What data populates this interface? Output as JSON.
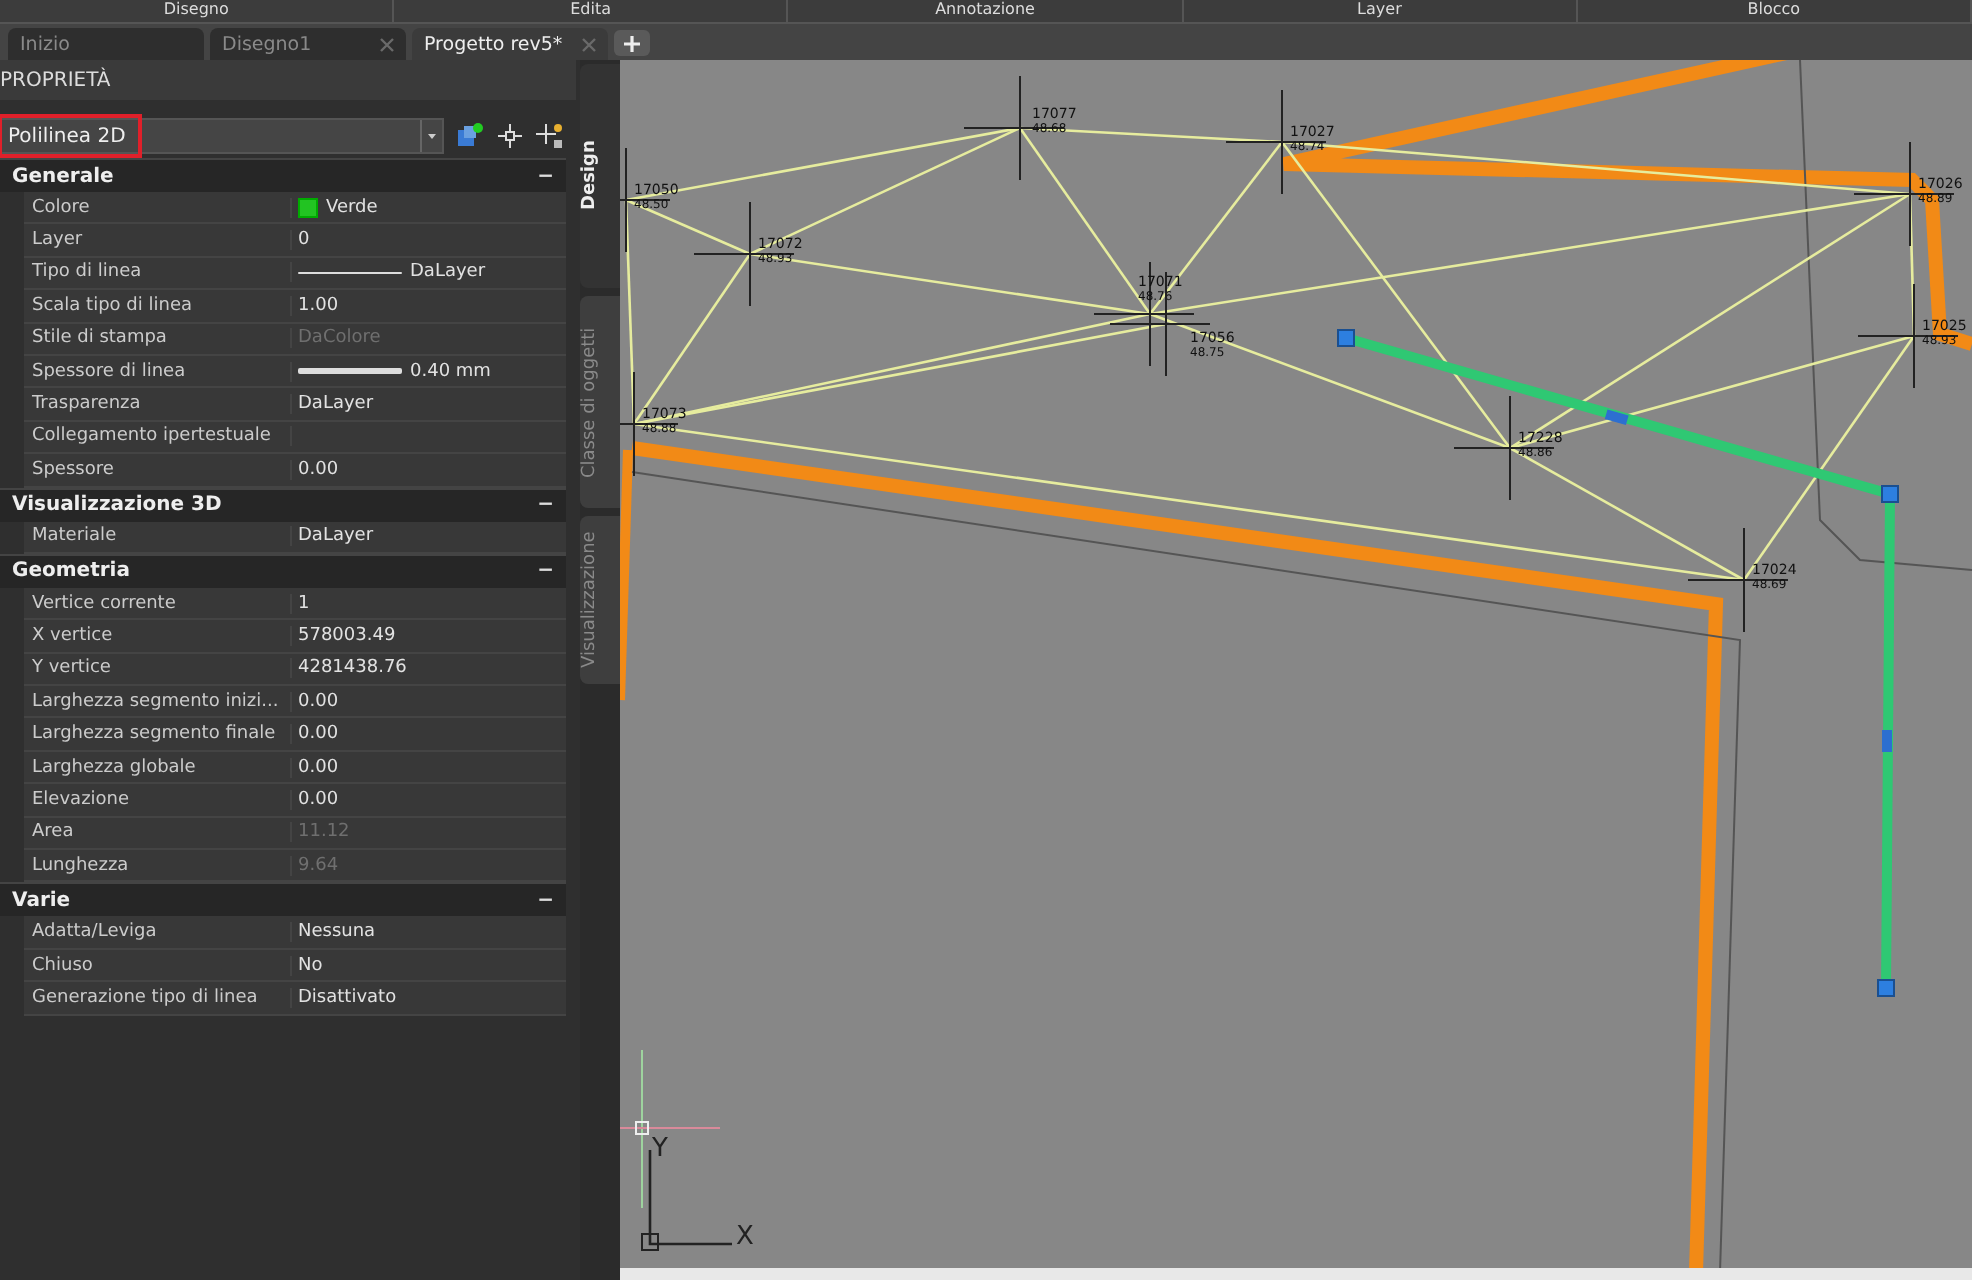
{
  "ribbon": {
    "labels": [
      "Disegno",
      "Edita",
      "Annotazione",
      "Layer",
      "Blocco"
    ]
  },
  "document_tabs": [
    {
      "label": "Inizio",
      "selected": false,
      "closable": false
    },
    {
      "label": "Disegno1",
      "selected": false,
      "closable": true
    },
    {
      "label": "Progetto rev5*",
      "selected": true,
      "closable": true
    }
  ],
  "properties_panel": {
    "title": "PROPRIETÀ",
    "object_selector": {
      "value": "Polilinea 2D",
      "highlighted": true
    },
    "sections": [
      {
        "title": "Generale",
        "toggle": "−",
        "rows": [
          {
            "label": "Colore",
            "value": "Verde",
            "kind": "color",
            "color": "#22c322",
            "disabled": false
          },
          {
            "label": "Layer",
            "value": "0",
            "kind": "text",
            "disabled": false
          },
          {
            "label": "Tipo di linea",
            "value": "DaLayer",
            "kind": "linetype",
            "disabled": false
          },
          {
            "label": "Scala tipo di linea",
            "value": "1.00",
            "kind": "text",
            "disabled": false
          },
          {
            "label": "Stile di stampa",
            "value": "DaColore",
            "kind": "text",
            "disabled": true
          },
          {
            "label": "Spessore di linea",
            "value": "0.40 mm",
            "kind": "lineweight",
            "disabled": false
          },
          {
            "label": "Trasparenza",
            "value": "DaLayer",
            "kind": "text",
            "disabled": false
          },
          {
            "label": "Collegamento ipertestuale",
            "kind": "text",
            "disabled": false
          },
          {
            "label": "Spessore",
            "value": "0.00",
            "kind": "text",
            "disabled": false
          }
        ]
      },
      {
        "title": "Visualizzazione 3D",
        "toggle": "−",
        "rows": [
          {
            "label": "Materiale",
            "value": "DaLayer",
            "kind": "text",
            "disabled": false
          }
        ]
      },
      {
        "title": "Geometria",
        "toggle": "−",
        "rows": [
          {
            "label": "Vertice corrente",
            "value": "1",
            "kind": "text",
            "disabled": false
          },
          {
            "label": "X vertice",
            "value": "578003.49",
            "kind": "text",
            "disabled": false
          },
          {
            "label": "Y vertice",
            "value": "4281438.76",
            "kind": "text",
            "disabled": false
          },
          {
            "label": "Larghezza  segmento  inizi...",
            "value": "0.00",
            "kind": "text",
            "disabled": false
          },
          {
            "label": "Larghezza segmento finale",
            "value": "0.00",
            "kind": "text",
            "disabled": false
          },
          {
            "label": "Larghezza globale",
            "value": "0.00",
            "kind": "text",
            "disabled": false
          },
          {
            "label": "Elevazione",
            "value": "0.00",
            "kind": "text",
            "disabled": false
          },
          {
            "label": "Area",
            "value": "11.12",
            "kind": "text",
            "disabled": true
          },
          {
            "label": "Lunghezza",
            "value": "9.64",
            "kind": "text",
            "disabled": true
          }
        ]
      },
      {
        "title": "Varie",
        "toggle": "−",
        "rows": [
          {
            "label": "Adatta/Leviga",
            "value": "Nessuna",
            "kind": "text",
            "disabled": false
          },
          {
            "label": "Chiuso",
            "value": "No",
            "kind": "text",
            "disabled": false
          },
          {
            "label": "Generazione tipo di linea",
            "value": "Disattivato",
            "kind": "text",
            "disabled": false
          }
        ]
      }
    ]
  },
  "side_tabs": [
    {
      "label": "Design",
      "selected": true
    },
    {
      "label": "Classe di oggetti",
      "selected": false
    },
    {
      "label": "Visualizzazione",
      "selected": false
    }
  ],
  "drawing": {
    "points": [
      {
        "id": "17077",
        "elevation": "48.68"
      },
      {
        "id": "17050",
        "elevation": "48.50"
      },
      {
        "id": "17072",
        "elevation": "48.93"
      },
      {
        "id": "17071",
        "elevation": "48.76"
      },
      {
        "id": "17056",
        "elevation": "48.75"
      },
      {
        "id": "17073",
        "elevation": "48.88"
      },
      {
        "id": "17027",
        "elevation": "48.74"
      },
      {
        "id": "17026",
        "elevation": "48.89"
      },
      {
        "id": "17025",
        "elevation": "48.93"
      },
      {
        "id": "17228",
        "elevation": "48.86"
      },
      {
        "id": "17024",
        "elevation": "48.69"
      }
    ],
    "ucs": {
      "x_label": "X",
      "y_label": "Y"
    }
  }
}
